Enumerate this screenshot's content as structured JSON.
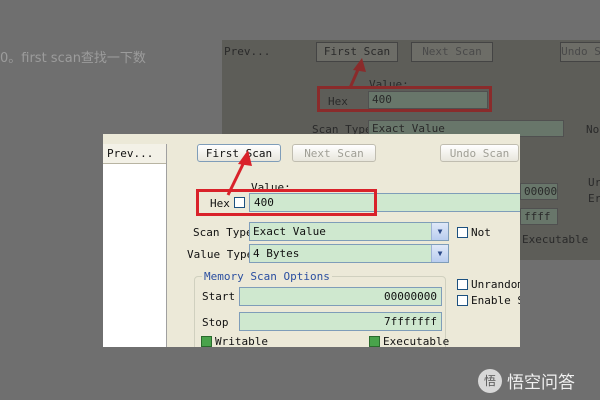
{
  "background": {
    "caption": "0。first scan查找一下数",
    "prev_label": "Prev...",
    "first_scan": "First Scan",
    "next_scan": "Next Scan",
    "undo_scan": "Undo S",
    "value_label": "Value:",
    "hex_label": "Hex",
    "hex_value": "400",
    "scan_type_label": "Scan Type",
    "scan_type_value": "Exact Value",
    "not_label": "Not",
    "start_value": "00000",
    "stop_value": "ffff",
    "executable_label": "Executable",
    "unrandom_label": "Ur",
    "enable_label": "Er"
  },
  "window": {
    "prev_header": "Prev...",
    "first_scan_label": "First Scan",
    "next_scan_label": "Next Scan",
    "undo_scan_label": "Undo Scan",
    "value_label": "Value:",
    "hex_label": "Hex",
    "hex_checked": false,
    "value_input": "400",
    "scan_type_label": "Scan Type",
    "scan_type_value": "Exact Value",
    "not_label": "Not",
    "value_type_label": "Value Type",
    "value_type_value": "4 Bytes",
    "memory_group_title": "Memory Scan Options",
    "start_label": "Start",
    "start_value": "00000000",
    "stop_label": "Stop",
    "stop_value": "7fffffff",
    "writable_label": "Writable",
    "executable_label": "Executable",
    "unrandom_label": "Unrandom",
    "enable_label": "Enable S"
  },
  "watermark": {
    "logo": "悟",
    "text": "悟空问答"
  },
  "colors": {
    "highlight": "#d9222a",
    "field_bg": "#cfe8cf",
    "window_bg": "#ece9d8",
    "group_title": "#2b4fa0"
  }
}
